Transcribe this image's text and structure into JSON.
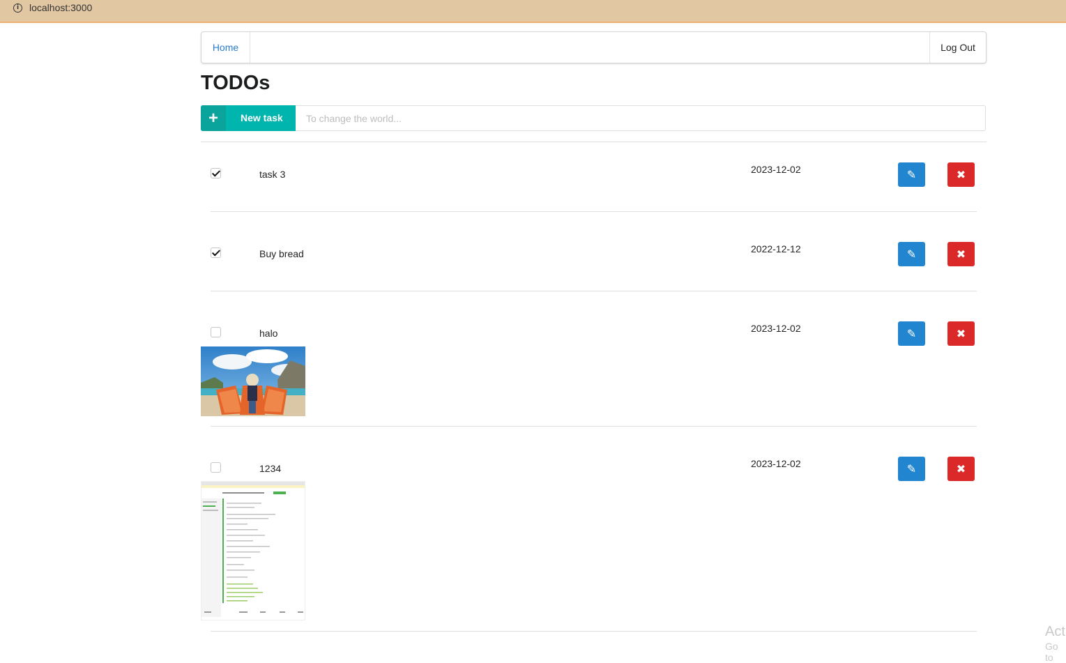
{
  "browser": {
    "url": "localhost:3000",
    "info_icon": "info-icon"
  },
  "nav": {
    "home": "Home",
    "logout": "Log Out"
  },
  "page": {
    "title": "TODOs"
  },
  "new_task": {
    "button_label": "New task",
    "icon": "plus-icon",
    "placeholder": "To change the world..."
  },
  "tasks": [
    {
      "name": "task 3",
      "date": "2023-12-02",
      "done": true
    },
    {
      "name": "Buy bread",
      "date": "2022-12-12",
      "done": true
    },
    {
      "name": "halo",
      "date": "2023-12-02",
      "done": false,
      "attachment": "beach-photo"
    },
    {
      "name": "1234",
      "date": "2023-12-02",
      "done": false,
      "attachment": "screenshot-thumbnail"
    }
  ],
  "icons": {
    "edit": "pencil-icon",
    "delete": "x-icon"
  },
  "colors": {
    "teal": "#00b5ad",
    "blue": "#2185d0",
    "red": "#db2828",
    "link": "#2a7ccc"
  },
  "watermark": {
    "line1": "Act",
    "line2": "Go to"
  }
}
